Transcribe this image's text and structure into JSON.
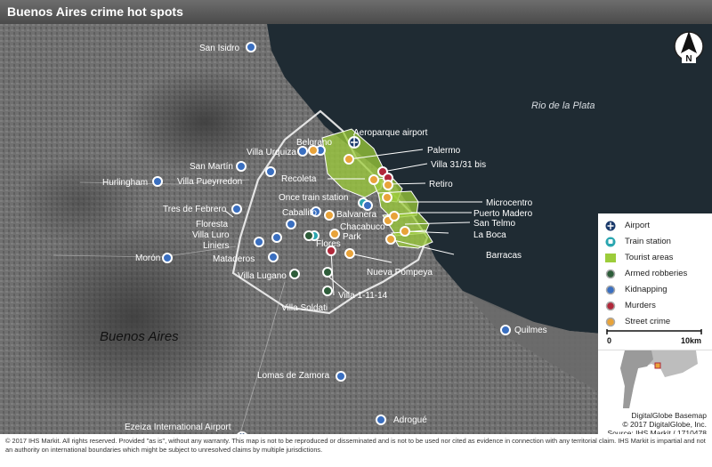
{
  "title": "Buenos Aires crime hot spots",
  "water_label": "Rio de la Plata",
  "region_label": "Buenos Aires",
  "north_label": "N",
  "places": [
    {
      "name": "San Isidro"
    },
    {
      "name": "Hurlingham"
    },
    {
      "name": "San Martín"
    },
    {
      "name": "Villa Urquiza"
    },
    {
      "name": "Villa Pueyrredon"
    },
    {
      "name": "Belgrano"
    },
    {
      "name": "Tres de Febrero"
    },
    {
      "name": "Floresta"
    },
    {
      "name": "Villa Luro"
    },
    {
      "name": "Liniers"
    },
    {
      "name": "Mataderos"
    },
    {
      "name": "Morón"
    },
    {
      "name": "Villa Lugano"
    },
    {
      "name": "Villa Soldati"
    },
    {
      "name": "Lomas de Zamora"
    },
    {
      "name": "Adrogué"
    },
    {
      "name": "Quilmes"
    },
    {
      "name": "Ezeiza International Airport"
    }
  ],
  "hotspots": [
    {
      "name": "Aeroparque airport"
    },
    {
      "name": "Palermo"
    },
    {
      "name": "Villa 31/31 bis"
    },
    {
      "name": "Recoleta"
    },
    {
      "name": "Retiro"
    },
    {
      "name": "Once train station"
    },
    {
      "name": "Balvanera"
    },
    {
      "name": "Caballito"
    },
    {
      "name": "Microcentro"
    },
    {
      "name": "Puerto Madero"
    },
    {
      "name": "San Telmo"
    },
    {
      "name": "La Boca"
    },
    {
      "name": "Chacabuco"
    },
    {
      "name": "Park"
    },
    {
      "name": "Flores"
    },
    {
      "name": "Barracas"
    },
    {
      "name": "Nueva Pompeya"
    },
    {
      "name": "Villa 1-11-14"
    }
  ],
  "legend": {
    "items": [
      {
        "label": "Airport",
        "symbol": "airport-icon",
        "color": "#1b3a6b"
      },
      {
        "label": "Train station",
        "symbol": "train-icon",
        "color": "#2aa6b0"
      },
      {
        "label": "Tourist areas",
        "symbol": "area-swatch",
        "color": "#9ccc3a"
      },
      {
        "label": "Armed robberies",
        "symbol": "dot",
        "color": "#2e5d3a"
      },
      {
        "label": "Kidnapping",
        "symbol": "dot",
        "color": "#3a6fc0"
      },
      {
        "label": "Murders",
        "symbol": "dot",
        "color": "#b0283a"
      },
      {
        "label": "Street crime",
        "symbol": "dot",
        "color": "#e8a33a"
      }
    ],
    "scale_start": "0",
    "scale_end": "10km"
  },
  "credits": {
    "line1": "DigitalGlobe Basemap",
    "line2": "© 2017 DigitalGlobe, Inc.",
    "line3": "Source: IHS Markit / 1710478"
  },
  "footer": "© 2017 IHS Markit. All rights reserved. Provided \"as is\", without any warranty. This map is not to be reproduced or disseminated and is not to be used nor cited as evidence in connection with any territorial claim. IHS Markit is impartial and not an authority on international boundaries which might be subject to unresolved claims by multiple jurisdictions."
}
